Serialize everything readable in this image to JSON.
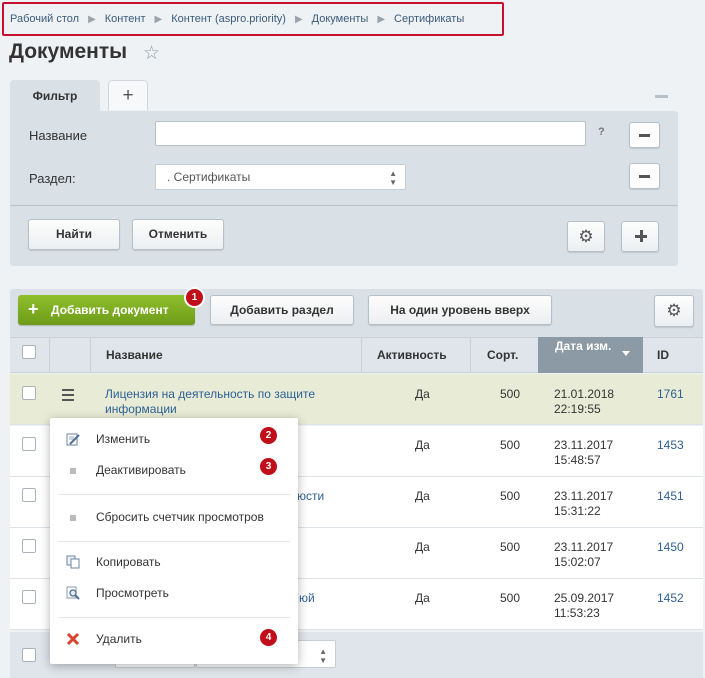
{
  "breadcrumb": [
    "Рабочий стол",
    "Контент",
    "Контент (aspro.priority)",
    "Документы",
    "Сертификаты"
  ],
  "page_title": "Документы",
  "filter": {
    "tab_label": "Фильтр",
    "add_tab": "+",
    "name_label": "Название",
    "name_value": "",
    "help": "?",
    "section_label": "Раздел:",
    "section_value": ". Сертификаты",
    "find_button": "Найти",
    "cancel_button": "Отменить"
  },
  "toolbar": {
    "add_document": "Добавить документ",
    "add_section": "Добавить раздел",
    "level_up": "На один уровень вверх"
  },
  "badges": [
    "1",
    "2",
    "3",
    "4"
  ],
  "table": {
    "headers": {
      "name": "Название",
      "active": "Активность",
      "sort": "Сорт.",
      "date": "Дата изм.",
      "id": "ID"
    },
    "rows": [
      {
        "name": "Лицензия на деятельность по защите информации",
        "active": "Да",
        "sort": "500",
        "date": "21.01.2018",
        "time": "22:19:55",
        "id": "1761"
      },
      {
        "name": "",
        "active": "Да",
        "sort": "500",
        "date": "23.11.2017",
        "time": "15:48:57",
        "id": "1453"
      },
      {
        "name": "юсти",
        "active": "Да",
        "sort": "500",
        "date": "23.11.2017",
        "time": "15:31:22",
        "id": "1451"
      },
      {
        "name": "",
        "active": "Да",
        "sort": "500",
        "date": "23.11.2017",
        "time": "15:02:07",
        "id": "1450"
      },
      {
        "name": "юй",
        "active": "Да",
        "sort": "500",
        "date": "25.09.2017",
        "time": "11:53:23",
        "id": "1452"
      }
    ]
  },
  "context_menu": {
    "edit": "Изменить",
    "deactivate": "Деактивировать",
    "reset_views": "Сбросить счетчик просмотров",
    "copy": "Копировать",
    "view": "Просмотреть",
    "delete": "Удалить"
  },
  "colors": {
    "accent_green": "#7aad1f",
    "badge_red": "#c00f1a",
    "highlight_border": "#c8102e",
    "link_blue": "#2d5f94"
  }
}
